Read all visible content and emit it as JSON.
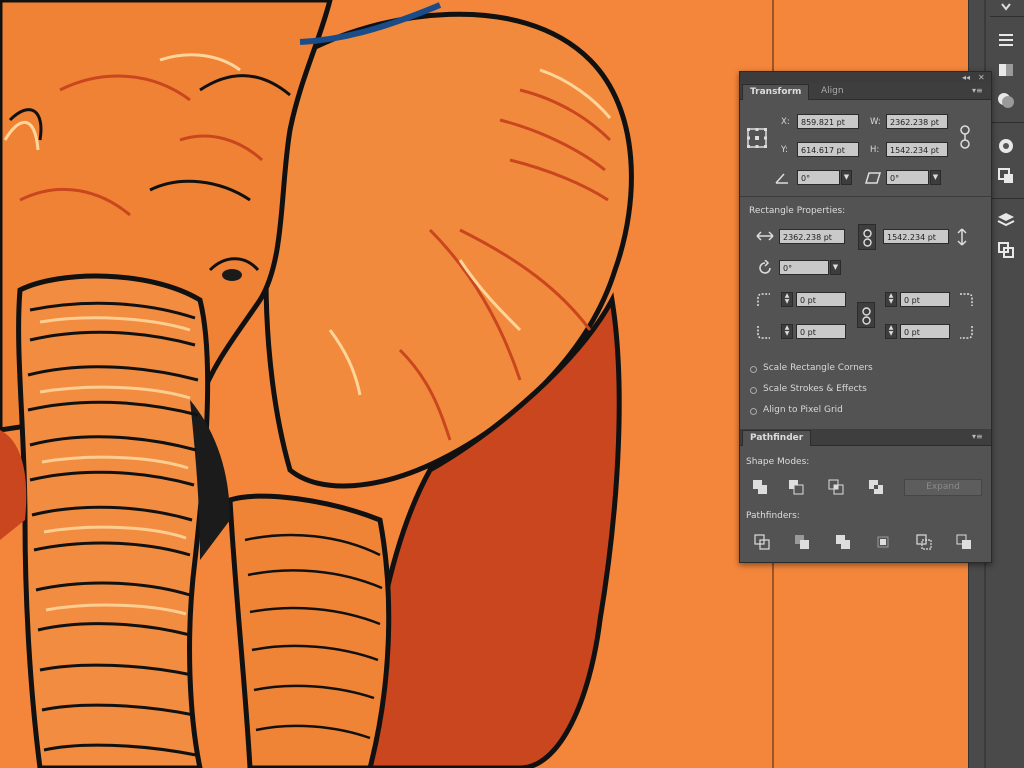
{
  "colors": {
    "canvas": "#f4863b",
    "panel": "#535353",
    "panel_dark": "#3e3e3e",
    "field": "#c9c9c9"
  },
  "transform": {
    "tabs": [
      {
        "label": "Transform"
      },
      {
        "label": "Align"
      }
    ],
    "x_label": "X:",
    "x_value": "859.821 pt",
    "y_label": "Y:",
    "y_value": "614.617 pt",
    "w_label": "W:",
    "w_value": "2362.238 pt",
    "h_label": "H:",
    "h_value": "1542.234 pt",
    "rotate_value": "0°",
    "shear_value": "0°"
  },
  "rectangle_properties": {
    "title": "Rectangle Properties:",
    "width_value": "2362.238 pt",
    "height_value": "1542.234 pt",
    "angle_value": "0°",
    "corner_top_left": "0 pt",
    "corner_top_right": "0 pt",
    "corner_bottom_left": "0 pt",
    "corner_bottom_right": "0 pt"
  },
  "options": [
    {
      "label": "Scale Rectangle Corners"
    },
    {
      "label": "Scale Strokes & Effects"
    },
    {
      "label": "Align to Pixel Grid"
    }
  ],
  "pathfinder": {
    "tab_label": "Pathfinder",
    "shape_modes_label": "Shape Modes:",
    "expand_label": "Expand",
    "pathfinders_label": "Pathfinders:"
  },
  "icons": {
    "shape_modes": [
      "unite-icon",
      "minus-front-icon",
      "intersect-icon",
      "exclude-icon"
    ],
    "pathfinders": [
      "divide-icon",
      "trim-icon",
      "merge-icon",
      "crop-icon",
      "outline-icon",
      "minus-back-icon"
    ]
  }
}
